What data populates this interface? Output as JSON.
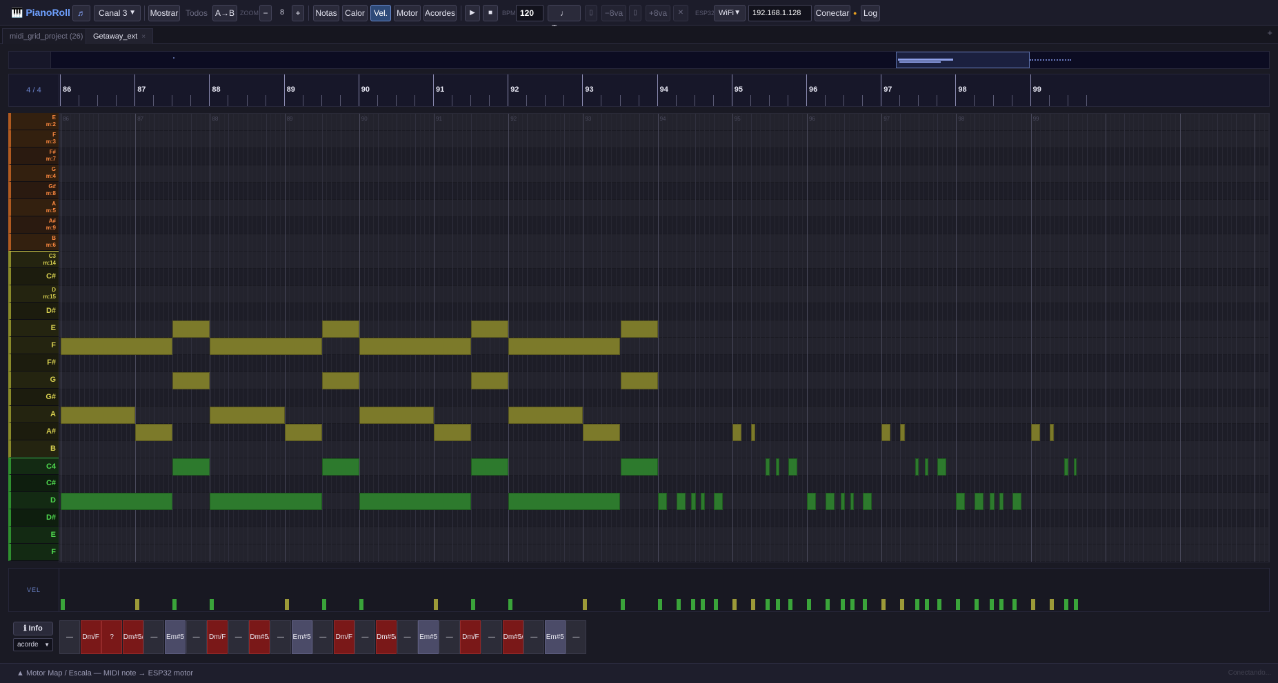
{
  "toolbar": {
    "logo": "🎹 PianoRoll",
    "logo_caret": "▾",
    "note_icon": "♬",
    "channel": "Canal 3",
    "show_label": "Mostrar",
    "all_label": "Todos",
    "ab_label": "A→B",
    "zoom_label": "ZOOM",
    "zoom_minus": "−",
    "zoom_value": "8",
    "zoom_plus": "+",
    "notes_label": "Notas",
    "heat_label": "Calor",
    "vel_label": "Vel.",
    "motor_label": "Motor",
    "chords_label": "Acordes",
    "play_icon": "▶",
    "stop_icon": "■",
    "bpm_label": "BPM",
    "bpm_value": "120",
    "tempo_label": "♩ Tempo",
    "octave_down": "−8va",
    "octave_up": "+8va",
    "close_icon": "✕",
    "esp_label": "ESP32",
    "conn_type": "WiFi",
    "ip": "192.168.1.128",
    "connect_label": "Conectar",
    "status_dot": "●",
    "log_label": "Log"
  },
  "tabs": [
    {
      "label": "midi_grid_project (26)",
      "close": "×"
    },
    {
      "label": "Getaway_ext",
      "close": "×"
    }
  ],
  "new_tab": "+",
  "ruler": {
    "time_signature": "4 / 4",
    "bars": [
      "86",
      "87",
      "88",
      "89",
      "90",
      "91",
      "92",
      "93",
      "94",
      "95",
      "96",
      "97",
      "98",
      "99"
    ]
  },
  "keys": [
    {
      "name": "E",
      "map": "m:2",
      "color": "#ff8a40"
    },
    {
      "name": "F",
      "map": "m:3",
      "color": "#ff8a40"
    },
    {
      "name": "F#",
      "map": "m:7",
      "color": "#ff8a40"
    },
    {
      "name": "G",
      "map": "m:4",
      "color": "#ff8a40"
    },
    {
      "name": "G#",
      "map": "m:8",
      "color": "#ff8a40"
    },
    {
      "name": "A",
      "map": "m:5",
      "color": "#ff8a40"
    },
    {
      "name": "A#",
      "map": "m:9",
      "color": "#ff8a40"
    },
    {
      "name": "B",
      "map": "m:6",
      "color": "#ff8a40"
    },
    {
      "name": "C3",
      "map": "m:14",
      "color": "#d8d050"
    },
    {
      "name": "C#",
      "map": "",
      "color": "#d8d050"
    },
    {
      "name": "D",
      "map": "m:15",
      "color": "#d8d050"
    },
    {
      "name": "D#",
      "map": "",
      "color": "#d8d050"
    },
    {
      "name": "E",
      "map": "",
      "color": "#d8d050"
    },
    {
      "name": "F",
      "map": "",
      "color": "#d8d050"
    },
    {
      "name": "F#",
      "map": "",
      "color": "#d8d050"
    },
    {
      "name": "G",
      "map": "",
      "color": "#d8d050"
    },
    {
      "name": "G#",
      "map": "",
      "color": "#d8d050"
    },
    {
      "name": "A",
      "map": "",
      "color": "#d8d050"
    },
    {
      "name": "A#",
      "map": "",
      "color": "#d8d050"
    },
    {
      "name": "B",
      "map": "",
      "color": "#d8d050"
    },
    {
      "name": "C4",
      "map": "",
      "color": "#50dc50"
    },
    {
      "name": "C#",
      "map": "",
      "color": "#50dc50"
    },
    {
      "name": "D",
      "map": "",
      "color": "#50dc50"
    },
    {
      "name": "D#",
      "map": "",
      "color": "#50dc50"
    },
    {
      "name": "E",
      "map": "",
      "color": "#50dc50"
    },
    {
      "name": "F",
      "map": "",
      "color": "#50dc50"
    }
  ],
  "notes": [
    {
      "row": 13,
      "start": 86.0,
      "len": 1.5
    },
    {
      "row": 13,
      "start": 88.0,
      "len": 1.5
    },
    {
      "row": 13,
      "start": 90.0,
      "len": 1.5
    },
    {
      "row": 13,
      "start": 92.0,
      "len": 1.5
    },
    {
      "row": 12,
      "start": 87.5,
      "len": 0.5
    },
    {
      "row": 12,
      "start": 89.5,
      "len": 0.5
    },
    {
      "row": 12,
      "start": 91.5,
      "len": 0.5
    },
    {
      "row": 12,
      "start": 93.5,
      "len": 0.5
    },
    {
      "row": 15,
      "start": 87.5,
      "len": 0.5
    },
    {
      "row": 15,
      "start": 89.5,
      "len": 0.5
    },
    {
      "row": 15,
      "start": 91.5,
      "len": 0.5
    },
    {
      "row": 15,
      "start": 93.5,
      "len": 0.5
    },
    {
      "row": 17,
      "start": 86.0,
      "len": 1.0
    },
    {
      "row": 17,
      "start": 88.0,
      "len": 1.0
    },
    {
      "row": 17,
      "start": 90.0,
      "len": 1.0
    },
    {
      "row": 17,
      "start": 92.0,
      "len": 1.0
    },
    {
      "row": 18,
      "start": 87.0,
      "len": 0.5
    },
    {
      "row": 18,
      "start": 89.0,
      "len": 0.5
    },
    {
      "row": 18,
      "start": 91.0,
      "len": 0.5
    },
    {
      "row": 18,
      "start": 93.0,
      "len": 0.5
    },
    {
      "row": 18,
      "start": 95.0,
      "len": 0.12
    },
    {
      "row": 18,
      "start": 95.25,
      "len": 0.06
    },
    {
      "row": 18,
      "start": 97.0,
      "len": 0.12
    },
    {
      "row": 18,
      "start": 97.25,
      "len": 0.06
    },
    {
      "row": 18,
      "start": 99.0,
      "len": 0.12
    },
    {
      "row": 18,
      "start": 99.25,
      "len": 0.06
    },
    {
      "row": 20,
      "start": 87.5,
      "len": 0.5
    },
    {
      "row": 20,
      "start": 89.5,
      "len": 0.5
    },
    {
      "row": 20,
      "start": 91.5,
      "len": 0.5
    },
    {
      "row": 20,
      "start": 93.5,
      "len": 0.5
    },
    {
      "row": 20,
      "start": 95.45,
      "len": 0.05
    },
    {
      "row": 20,
      "start": 95.58,
      "len": 0.05
    },
    {
      "row": 20,
      "start": 95.75,
      "len": 0.12
    },
    {
      "row": 20,
      "start": 97.45,
      "len": 0.05
    },
    {
      "row": 20,
      "start": 97.58,
      "len": 0.05
    },
    {
      "row": 20,
      "start": 97.75,
      "len": 0.12
    },
    {
      "row": 20,
      "start": 99.45,
      "len": 0.05
    },
    {
      "row": 20,
      "start": 99.58,
      "len": 0.03
    },
    {
      "row": 22,
      "start": 86.0,
      "len": 1.5
    },
    {
      "row": 22,
      "start": 88.0,
      "len": 1.5
    },
    {
      "row": 22,
      "start": 90.0,
      "len": 1.5
    },
    {
      "row": 22,
      "start": 92.0,
      "len": 1.5
    },
    {
      "row": 22,
      "start": 94.0,
      "len": 0.12
    },
    {
      "row": 22,
      "start": 94.25,
      "len": 0.12
    },
    {
      "row": 22,
      "start": 94.45,
      "len": 0.06
    },
    {
      "row": 22,
      "start": 94.58,
      "len": 0.05
    },
    {
      "row": 22,
      "start": 94.75,
      "len": 0.12
    },
    {
      "row": 22,
      "start": 96.0,
      "len": 0.12
    },
    {
      "row": 22,
      "start": 96.25,
      "len": 0.12
    },
    {
      "row": 22,
      "start": 96.45,
      "len": 0.06
    },
    {
      "row": 22,
      "start": 96.58,
      "len": 0.05
    },
    {
      "row": 22,
      "start": 96.75,
      "len": 0.12
    },
    {
      "row": 22,
      "start": 98.0,
      "len": 0.12
    },
    {
      "row": 22,
      "start": 98.25,
      "len": 0.12
    },
    {
      "row": 22,
      "start": 98.45,
      "len": 0.06
    },
    {
      "row": 22,
      "start": 98.58,
      "len": 0.05
    },
    {
      "row": 22,
      "start": 98.75,
      "len": 0.12
    }
  ],
  "chords": [
    "—",
    "Dm/F",
    "?",
    "Dm#5/",
    "—",
    "Em#5",
    "—",
    "Dm/F",
    "—",
    "Dm#5/",
    "—",
    "Em#5",
    "—",
    "Dm/F",
    "—",
    "Dm#5/",
    "—",
    "Em#5",
    "—",
    "Dm/F",
    "—",
    "Dm#5/",
    "—",
    "Em#5",
    "—"
  ],
  "chord_styles": [
    "n",
    "red",
    "red",
    "red",
    "n",
    "blue",
    "n",
    "red",
    "n",
    "red",
    "n",
    "blue",
    "n",
    "red",
    "n",
    "red",
    "n",
    "blue",
    "n",
    "red",
    "n",
    "red",
    "n",
    "blue",
    "n"
  ],
  "info_label": "ℹ Info",
  "mode": "acorde",
  "vel_title": "VEL",
  "footer": {
    "text": "▲  Motor Map / Escala — MIDI note → ESP32 motor",
    "status": "Conectando..."
  },
  "colors": {
    "yellow_note": "#7c7a2a",
    "green_note": "#2d7a2d",
    "vel_yellow": "#9c9a38",
    "vel_green": "#3aa43a",
    "accent": "#6ea0ff"
  },
  "zoom_level": 8
}
